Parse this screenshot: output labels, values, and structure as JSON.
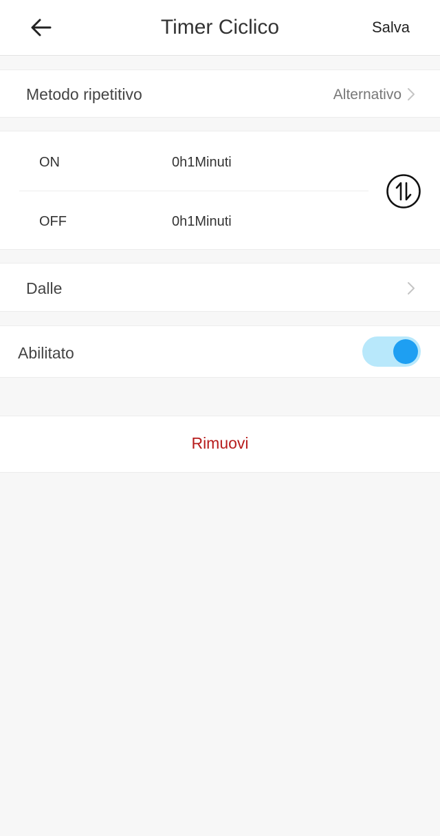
{
  "header": {
    "title": "Timer Ciclico",
    "save_label": "Salva",
    "back_icon": "arrow-left-icon"
  },
  "repeat_method": {
    "label": "Metodo ripetitivo",
    "value": "Alternativo",
    "chevron_icon": "chevron-right-icon"
  },
  "timer": {
    "on_label": "ON",
    "on_value": "0h1Minuti",
    "off_label": "OFF",
    "off_value": "0h1Minuti",
    "swap_icon": "swap-vertical-circle-icon"
  },
  "from": {
    "label": "Dalle",
    "chevron_icon": "chevron-right-icon"
  },
  "enabled": {
    "label": "Abilitato",
    "state": true
  },
  "remove": {
    "label": "Rimuovi"
  },
  "colors": {
    "toggle_track": "#b8e8fb",
    "toggle_knob": "#1e9ff2",
    "remove_text": "#b71c1c",
    "page_background": "#f7f7f7"
  }
}
